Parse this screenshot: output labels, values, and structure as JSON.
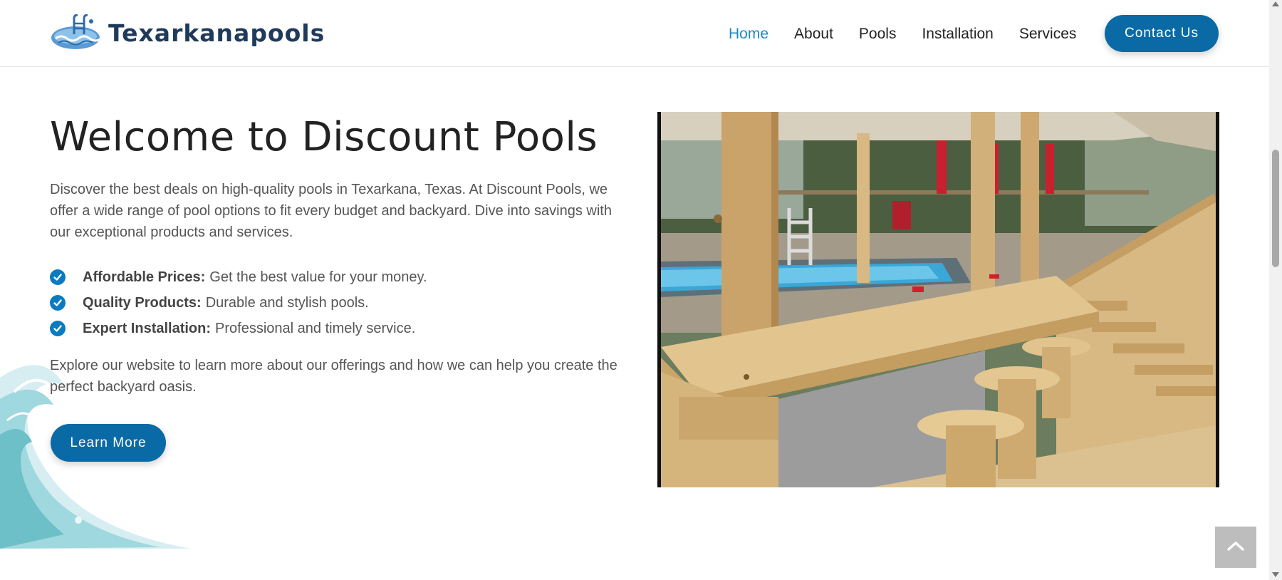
{
  "brand": {
    "name": "Texarkanapools",
    "logo_icon": "pool-ladder-logo-icon"
  },
  "nav": {
    "items": [
      {
        "label": "Home",
        "active": true
      },
      {
        "label": "About",
        "active": false
      },
      {
        "label": "Pools",
        "active": false
      },
      {
        "label": "Installation",
        "active": false
      },
      {
        "label": "Services",
        "active": false
      }
    ],
    "contact_label": "Contact Us"
  },
  "hero": {
    "title": "Welcome to Discount Pools",
    "intro": "Discover the best deals on high-quality pools in Texarkana, Texas. At Discount Pools, we offer a wide range of pool options to fit every budget and backyard. Dive into savings with our exceptional products and services.",
    "features": [
      {
        "label": "Affordable Prices:",
        "text": "Get the best value for your money."
      },
      {
        "label": "Quality Products:",
        "text": "Durable and stylish pools."
      },
      {
        "label": "Expert Installation:",
        "text": "Professional and timely service."
      }
    ],
    "outro": "Explore our website to learn more about our offerings and how we can help you create the perfect backyard oasis.",
    "cta_label": "Learn More",
    "photo_alt": "wooden-pool-deck-photo"
  },
  "icons": {
    "check": "check-circle-icon",
    "back_to_top": "chevron-up-icon"
  },
  "colors": {
    "accent": "#0a6aa6",
    "nav_active": "#1b87c9",
    "brand_text": "#1f3a5a"
  }
}
